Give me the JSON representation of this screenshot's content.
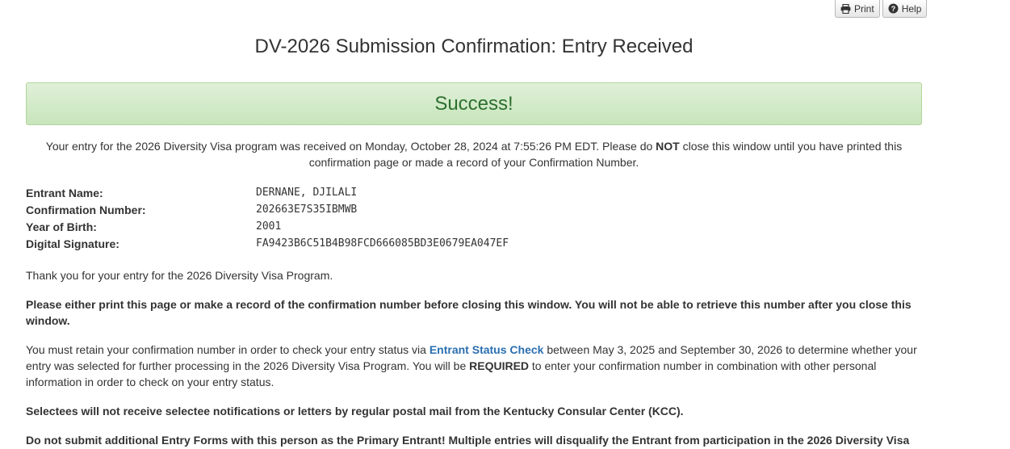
{
  "toolbar": {
    "print_label": "Print",
    "help_label": "Help"
  },
  "title": "DV-2026 Submission Confirmation: Entry Received",
  "alert": {
    "text": "Success!"
  },
  "intro": {
    "part1": "Your entry for the 2026 Diversity Visa program was received on Monday, October 28, 2024 at 7:55:26 PM EDT. Please do ",
    "emph": "NOT",
    "part2": " close this window until you have printed this confirmation page or made a record of your Confirmation Number."
  },
  "details": [
    {
      "label": "Entrant Name:",
      "value": "DERNANE, DJILALI"
    },
    {
      "label": "Confirmation Number:",
      "value": "202663E7S35IBMWB"
    },
    {
      "label": "Year of Birth:",
      "value": "2001"
    },
    {
      "label": "Digital Signature:",
      "value": "FA9423B6C51B4B98FCD666085BD3E0679EA047EF"
    }
  ],
  "paragraphs": {
    "thanks": "Thank you for your entry for the 2026 Diversity Visa Program.",
    "print_notice": "Please either print this page or make a record of the confirmation number before closing this window. You will not be able to retrieve this number after you close this window.",
    "retain_part1": "You must retain your confirmation number in order to check your entry status via ",
    "retain_link": "Entrant Status Check",
    "retain_part2": " between May 3, 2025 and September 30, 2026 to determine whether your entry was selected for further processing in the 2026 Diversity Visa Program. You will be ",
    "retain_emph": "REQUIRED",
    "retain_part3": " to enter your confirmation number in combination with other personal information in order to check on your entry status.",
    "selectees": "Selectees will not receive selectee notifications or letters by regular postal mail from the Kentucky Consular Center (KCC).",
    "no_additional": "Do not submit additional Entry Forms with this person as the Primary Entrant! Multiple entries will disqualify the Entrant from participation in the 2026 Diversity Visa"
  },
  "colors": {
    "success_text": "#2d6f2f",
    "success_bg": "#dff0d8",
    "link": "#2a6fb0"
  },
  "icons": {
    "print": "printer-icon",
    "help": "question-circle-icon"
  }
}
